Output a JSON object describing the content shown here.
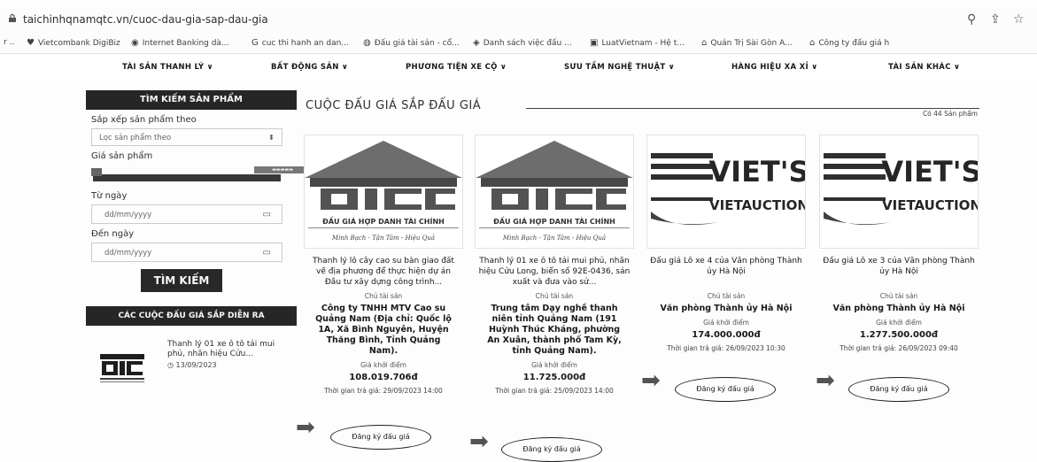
{
  "browser": {
    "url": "taichinhqnamqtc.vn/cuoc-dau-gia-sap-dau-gia",
    "bookmarks": [
      "Vietcombank DigiBiz",
      "Internet Banking dà...",
      "cuc thi hanh an dan...",
      "Đấu giá tài sản - cổ...",
      "Danh sách việc đấu ...",
      "LuatVietnam - Hệ t...",
      "Quản Trị Sài Gòn A...",
      "Công ty đấu giá h"
    ]
  },
  "nav": {
    "items": [
      "TÀI SẢN THANH LÝ ∨",
      "BẤT ĐỘNG SẢN ∨",
      "PHƯƠNG TIỆN XE CỘ ∨",
      "SƯU TẦM NGHỆ THUẬT ∨",
      "HÀNG HIỆU XA XỈ ∨",
      "TÀI SẢN KHÁC ∨"
    ]
  },
  "sidebar": {
    "search_title": "TÌM KIẾM SẢN PHẨM",
    "sort_label": "Sắp xếp sản phẩm theo",
    "sort_value": "Lọc sản phẩm theo",
    "price_label": "Giá sản phẩm",
    "from_label": "Từ ngày",
    "to_label": "Đến ngày",
    "date_placeholder": "dd/mm/yyyy",
    "search_button": "TÌM KIẾM",
    "upcoming_title": "CÁC CUỘC ĐẤU GIÁ SẮP DIỄN RA",
    "upcoming_item_title": "Thanh lý 01 xe ô tô tải mui phủ, nhãn hiệu Cửu...",
    "upcoming_item_date": "13/09/2023"
  },
  "main": {
    "title": "CUỘC ĐẤU GIÁ SẮP ĐẤU GIÁ",
    "count": "Có 44 Sản phẩm",
    "owner_label": "Chủ tài sản",
    "start_price_label": "Giá khởi điểm",
    "register_label": "Đăng ký đấu giá",
    "logo_text": {
      "otc_caption": "ĐẤU GIÁ HỢP DANH TÀI CHÍNH",
      "otc_slogan": "Minh Bạch - Tận Tâm - Hiệu Quả",
      "viet_big": "VIET'S",
      "viet_sub": "VIETAUCTION"
    },
    "cards": [
      {
        "title": "Thanh lý lô cây cao su bàn giao đất về địa phương để thực hiện dự án Đầu tư xây dựng công trình...",
        "owner": "Công ty TNHH MTV Cao su Quảng Nam (Địa chỉ: Quốc lộ 1A, Xã Bình Nguyên, Huyện Thăng Bình, Tỉnh Quảng Nam).",
        "price": "108.019.706đ",
        "time": "Thời gian trả giá: 29/09/2023 14:00"
      },
      {
        "title": "Thanh lý 01 xe ô tô tải mui phủ, nhãn hiệu Cửu Long, biển số 92E-0436, sản xuất và đưa vào sử...",
        "owner": "Trung tâm Dạy nghề thanh niên tỉnh Quảng Nam (191 Huỳnh Thúc Kháng, phường An Xuân, thành phố Tam Kỳ, tỉnh Quảng Nam).",
        "price": "11.725.000đ",
        "time": "Thời gian trả giá: 25/09/2023 14:00"
      },
      {
        "title": "Đấu giá Lô xe 4 của Văn phòng Thành ủy Hà Nội",
        "owner": "Văn phòng Thành ủy Hà Nội",
        "price": "174.000.000đ",
        "time": "Thời gian trả giá: 26/09/2023 10:30"
      },
      {
        "title": "Đấu giá Lô xe 3 của Văn phòng Thành ủy Hà Nội",
        "owner": "Văn phòng Thành ủy Hà Nội",
        "price": "1.277.500.000đ",
        "time": "Thời gian trả giá: 26/09/2023 09:40"
      }
    ]
  }
}
